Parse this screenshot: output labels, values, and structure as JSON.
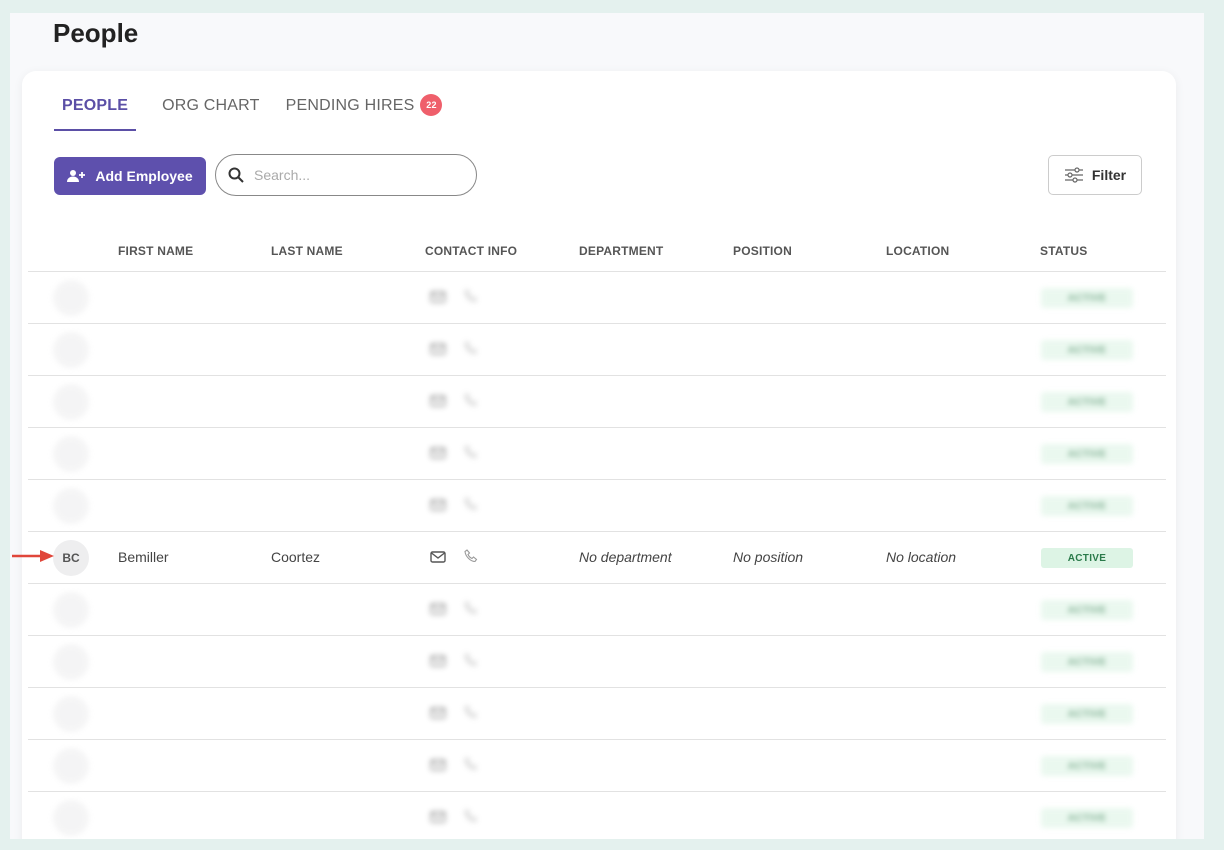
{
  "page": {
    "title": "People"
  },
  "tabs": [
    {
      "label": "PEOPLE",
      "active": true
    },
    {
      "label": "ORG CHART",
      "active": false
    },
    {
      "label": "PENDING HIRES",
      "active": false,
      "badge": "22"
    }
  ],
  "toolbar": {
    "add_label": "Add Employee",
    "search_placeholder": "Search...",
    "filter_label": "Filter"
  },
  "columns": [
    "FIRST NAME",
    "LAST NAME",
    "CONTACT INFO",
    "DEPARTMENT",
    "POSITION",
    "LOCATION",
    "STATUS"
  ],
  "rows": [
    {
      "initials": "",
      "first": "",
      "last": "",
      "department": "",
      "position": "",
      "location": "",
      "status": "ACTIVE",
      "blurred": true
    },
    {
      "initials": "",
      "first": "",
      "last": "",
      "department": "",
      "position": "",
      "location": "",
      "status": "ACTIVE",
      "blurred": true
    },
    {
      "initials": "",
      "first": "",
      "last": "",
      "department": "",
      "position": "",
      "location": "",
      "status": "ACTIVE",
      "blurred": true
    },
    {
      "initials": "",
      "first": "",
      "last": "",
      "department": "",
      "position": "",
      "location": "",
      "status": "ACTIVE",
      "blurred": true
    },
    {
      "initials": "",
      "first": "",
      "last": "",
      "department": "",
      "position": "",
      "location": "",
      "status": "ACTIVE",
      "blurred": true
    },
    {
      "initials": "BC",
      "first": "Bemiller",
      "last": "Coortez",
      "department": "No department",
      "position": "No position",
      "location": "No location",
      "status": "ACTIVE",
      "blurred": false,
      "highlighted": true
    },
    {
      "initials": "",
      "first": "",
      "last": "",
      "department": "",
      "position": "",
      "location": "",
      "status": "ACTIVE",
      "blurred": true
    },
    {
      "initials": "",
      "first": "",
      "last": "",
      "department": "",
      "position": "",
      "location": "",
      "status": "ACTIVE",
      "blurred": true
    },
    {
      "initials": "",
      "first": "",
      "last": "",
      "department": "",
      "position": "",
      "location": "",
      "status": "ACTIVE",
      "blurred": true
    },
    {
      "initials": "",
      "first": "",
      "last": "",
      "department": "",
      "position": "",
      "location": "",
      "status": "ACTIVE",
      "blurred": true
    },
    {
      "initials": "",
      "first": "",
      "last": "",
      "department": "",
      "position": "",
      "location": "",
      "status": "ACTIVE",
      "blurred": true
    }
  ],
  "colors": {
    "accent": "#5e50ad",
    "badge": "#ef5f6b",
    "status_bg": "#ddf4e5",
    "arrow": "#e0463a"
  }
}
